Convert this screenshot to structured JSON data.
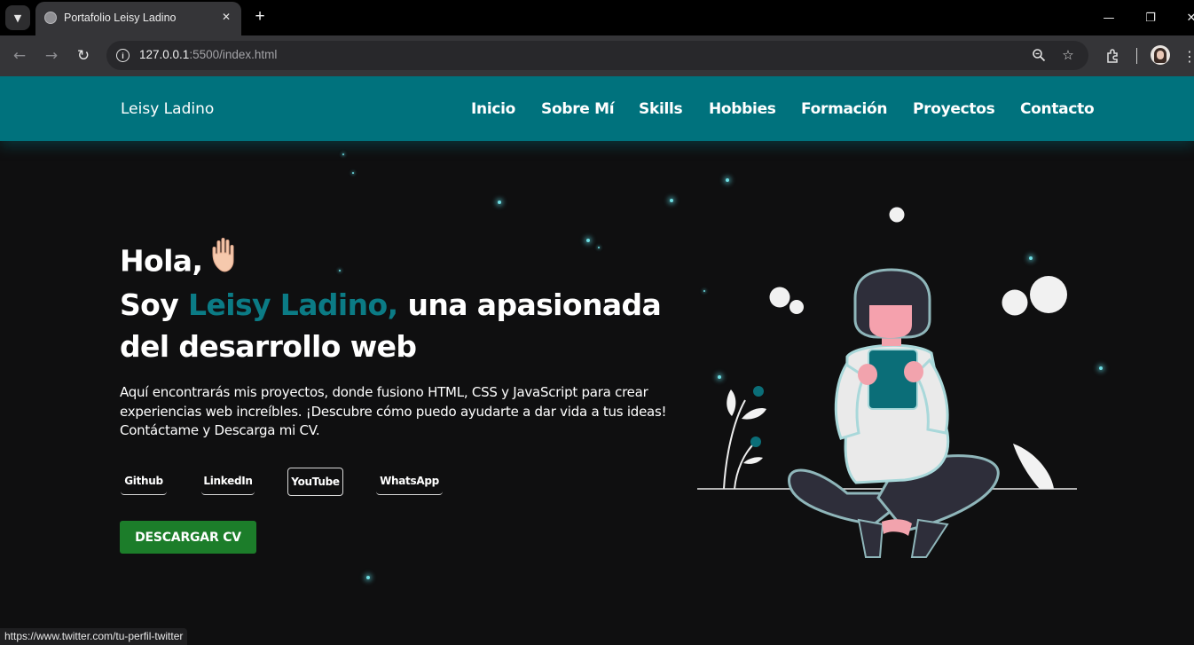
{
  "browser": {
    "tab": {
      "title": "Portafolio Leisy Ladino"
    },
    "address_bar": {
      "host": "127.0.0.1",
      "path": ":5500/index.html"
    },
    "status_url": "https://www.twitter.com/tu-perfil-twitter"
  },
  "site": {
    "brand": "Leisy Ladino",
    "nav": [
      "Inicio",
      "Sobre Mí",
      "Skills",
      "Hobbies",
      "Formación",
      "Proyectos",
      "Contacto"
    ],
    "hero": {
      "greeting": "Hola,",
      "intro_prefix": "Soy",
      "name": "Leisy Ladino,",
      "intro_suffix": "una apasionada",
      "intro_line3": "del desarrollo web",
      "description": "Aquí encontrarás mis proyectos, donde fusiono HTML, CSS y JavaScript para crear experiencias web increíbles. ¡Descubre cómo puedo ayudarte a dar vida a tus ideas! Contáctame y Descarga mi CV.",
      "social_links": [
        "Github",
        "LinkedIn",
        "YouTube",
        "WhatsApp"
      ],
      "cta": "DESCARGAR CV"
    }
  },
  "colors": {
    "header_bg": "#00727d",
    "accent_name": "#0b7b85",
    "cta_bg": "#1c7d2a",
    "page_bg": "#0f0f10"
  }
}
